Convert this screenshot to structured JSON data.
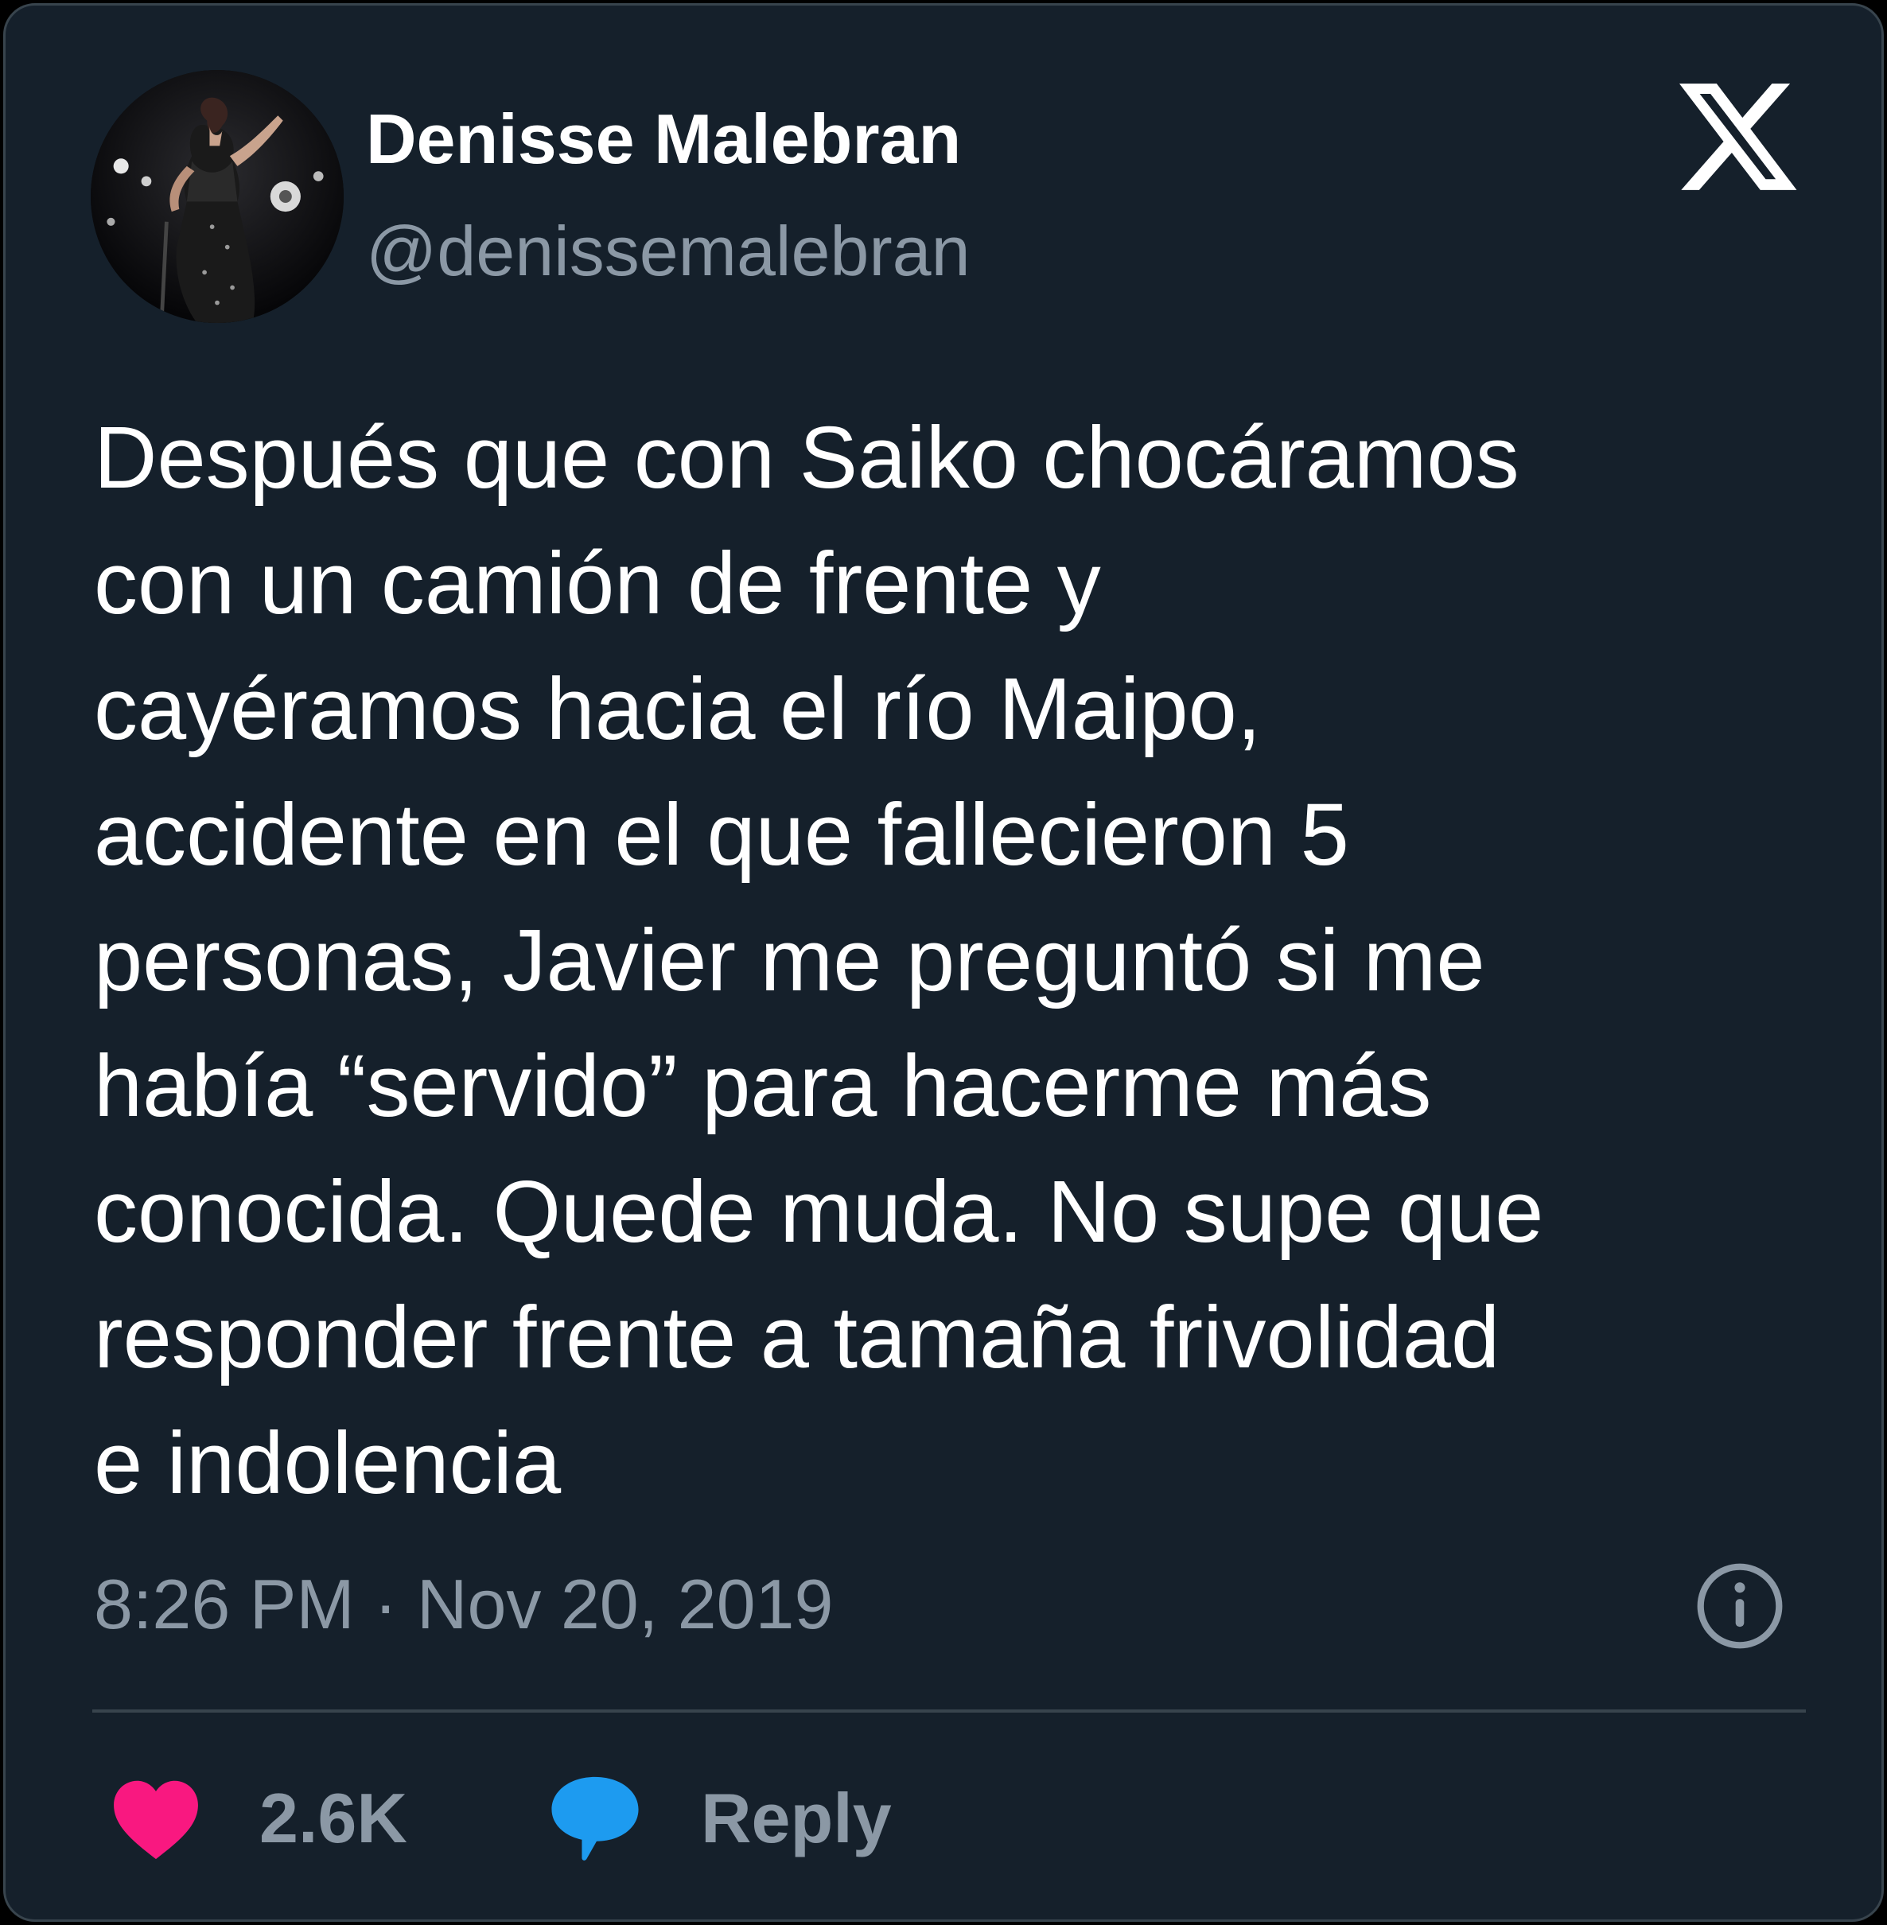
{
  "author": {
    "display_name": "Denisse Malebran",
    "handle": "@denissemalebran",
    "avatar_icon": "profile-photo"
  },
  "brand": {
    "logo_icon": "x-logo-icon"
  },
  "tweet": {
    "lines": [
      "Después que con Saiko chocáramos",
      "con un camión de frente y",
      "cayéramos hacia el río Maipo,",
      "accidente en el que fallecieron 5",
      "personas, Javier me preguntó si me",
      "había “servido” para hacerme más",
      "conocida. Quede muda. No supe que",
      "responder frente a tamaña frivolidad",
      "e indolencia"
    ],
    "timestamp": "8:26 PM · Nov 20, 2019"
  },
  "actions": {
    "like_count": "2.6K",
    "reply_label": "Reply",
    "like_icon": "heart-icon",
    "reply_icon": "speech-bubble-icon",
    "info_icon": "info-icon"
  },
  "colors": {
    "background": "#15202b",
    "border": "#38444d",
    "text_primary": "#ffffff",
    "text_secondary": "#8b98a5",
    "like": "#f91880",
    "reply": "#1d9bf0"
  }
}
